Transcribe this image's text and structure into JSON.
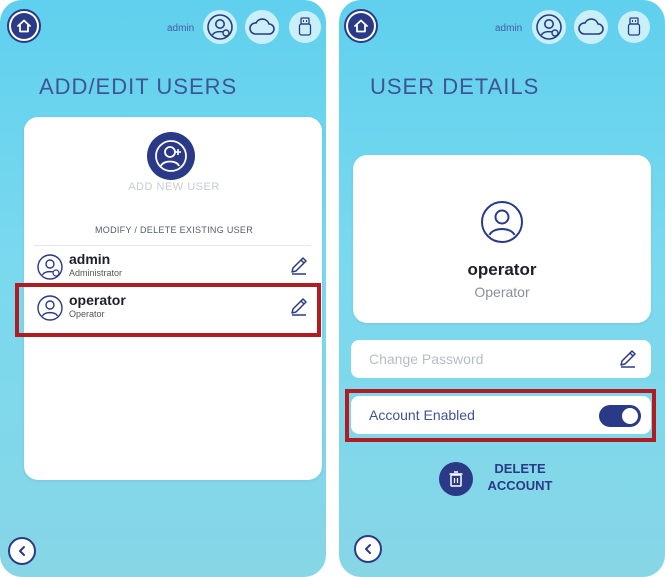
{
  "header": {
    "admin_label": "admin",
    "icons": [
      "home-icon",
      "user-gear-icon",
      "cloud-icon",
      "usb-icon"
    ]
  },
  "users_screen": {
    "title": "ADD/EDIT USERS",
    "add_new_user_label": "ADD NEW USER",
    "modify_label": "MODIFY / DELETE EXISTING USER",
    "users": [
      {
        "name": "admin",
        "role": "Administrator"
      },
      {
        "name": "operator",
        "role": "Operator"
      }
    ]
  },
  "details_screen": {
    "title": "USER DETAILS",
    "user_name": "operator",
    "user_role": "Operator",
    "password_placeholder": "Change Password",
    "account_enabled_label": "Account Enabled",
    "account_enabled": true,
    "delete_label_line1": "DELETE",
    "delete_label_line2": "ACCOUNT"
  },
  "colors": {
    "accent": "#2b3a86",
    "title": "#3f5496",
    "highlight": "#b01c22",
    "background_top": "#5fd0ee",
    "background_bottom": "#86d6e6"
  }
}
